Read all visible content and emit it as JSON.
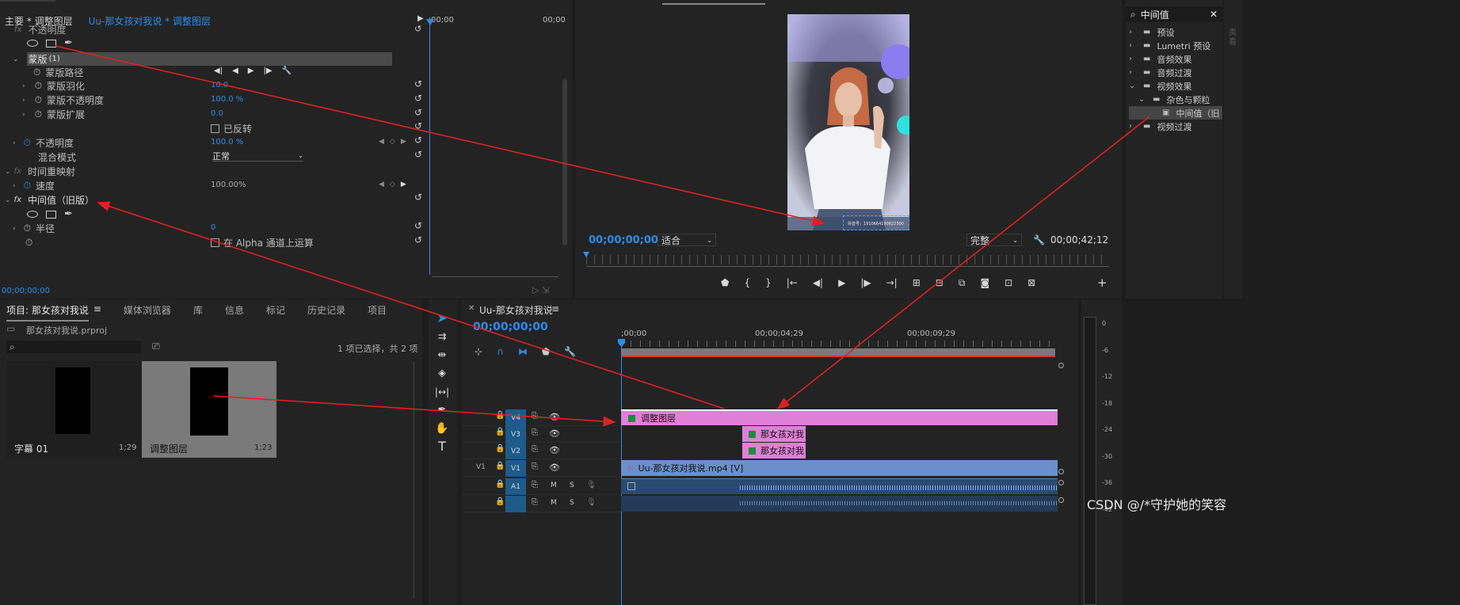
{
  "effect_controls": {
    "tab_label": "主要 * 调整图层",
    "clip_label": "Uu-那女孩对我说 * 调整图层",
    "ruler_start": "00;00",
    "ruler_end": "00;00",
    "prev_row_label": "不透明度",
    "mask_label": "蒙版",
    "mask_count": "(1)",
    "rows": [
      {
        "label": "蒙版路径",
        "value": ""
      },
      {
        "label": "蒙版羽化",
        "value": "10.0"
      },
      {
        "label": "蒙版不透明度",
        "value": "100.0 %"
      },
      {
        "label": "蒙版扩展",
        "value": "0.0"
      }
    ],
    "inverted_label": "已反转",
    "opacity_label": "不透明度",
    "opacity_value": "100.0 %",
    "blend_label": "混合模式",
    "blend_value": "正常",
    "time_remap_label": "时间重映射",
    "speed_label": "速度",
    "speed_value": "100.00%",
    "median_label": "中间值（旧版）",
    "radius_label": "半径",
    "radius_value": "0",
    "alpha_label": "在 Alpha 通道上运算",
    "timecode": "00;00;00;00"
  },
  "program_monitor": {
    "timecode": "00;00;00;00",
    "fit_value": "适合",
    "quality_value": "完整",
    "duration": "00;00;42;12",
    "watermark": "抖音号：1910664190822300"
  },
  "effects_panel": {
    "search_value": "中间值",
    "items": [
      {
        "label": "预设",
        "level": 0,
        "open": false
      },
      {
        "label": "Lumetri 预设",
        "level": 0,
        "open": false
      },
      {
        "label": "音频效果",
        "level": 0,
        "open": false
      },
      {
        "label": "音频过渡",
        "level": 0,
        "open": false
      },
      {
        "label": "视频效果",
        "level": 0,
        "open": true
      },
      {
        "label": "杂色与颗粒",
        "level": 1,
        "open": true
      },
      {
        "label": "中间值（旧",
        "level": 2,
        "open": false
      },
      {
        "label": "视频过渡",
        "level": 0,
        "open": false
      }
    ],
    "side_label": "类看"
  },
  "project": {
    "tabs": [
      "项目: 那女孩对我说",
      "媒体浏览器",
      "库",
      "信息",
      "标记",
      "历史记录",
      "项目"
    ],
    "file_name": "那女孩对我说.prproj",
    "selection_info": "1 项已选择，共 2 项",
    "items": [
      {
        "name": "字幕 01",
        "duration": "1;29"
      },
      {
        "name": "调整图层",
        "duration": "1;23"
      }
    ]
  },
  "timeline": {
    "tab_label": "Uu-那女孩对我说",
    "timecode": "00;00;00;00",
    "ruler": [
      ";00;00",
      "00;00;04;29",
      "00;00;09;29"
    ],
    "tracks": [
      {
        "name": "V4",
        "src": ""
      },
      {
        "name": "V3",
        "src": ""
      },
      {
        "name": "V2",
        "src": ""
      },
      {
        "name": "V1",
        "src": "V1"
      },
      {
        "name": "A1",
        "src": ""
      },
      {
        "name": "",
        "src": ""
      }
    ],
    "mute_label": "M",
    "solo_label": "S",
    "clips": {
      "adjust": "调整图层",
      "v3": "那女孩对我",
      "v2": "那女孩对我",
      "v1": "Uu-那女孩对我说.mp4 [V]"
    }
  },
  "meter": {
    "ticks": [
      "0",
      "-6",
      "-12",
      "-18",
      "-24",
      "-30",
      "-36",
      "-42"
    ]
  },
  "watermark": "CSDN @/*守护她的笑容",
  "colors": {
    "accent": "#2d8ceb",
    "clip_pink": "#e07fd8",
    "clip_blue": "#6b8fc8",
    "arrow": "#e02020"
  }
}
